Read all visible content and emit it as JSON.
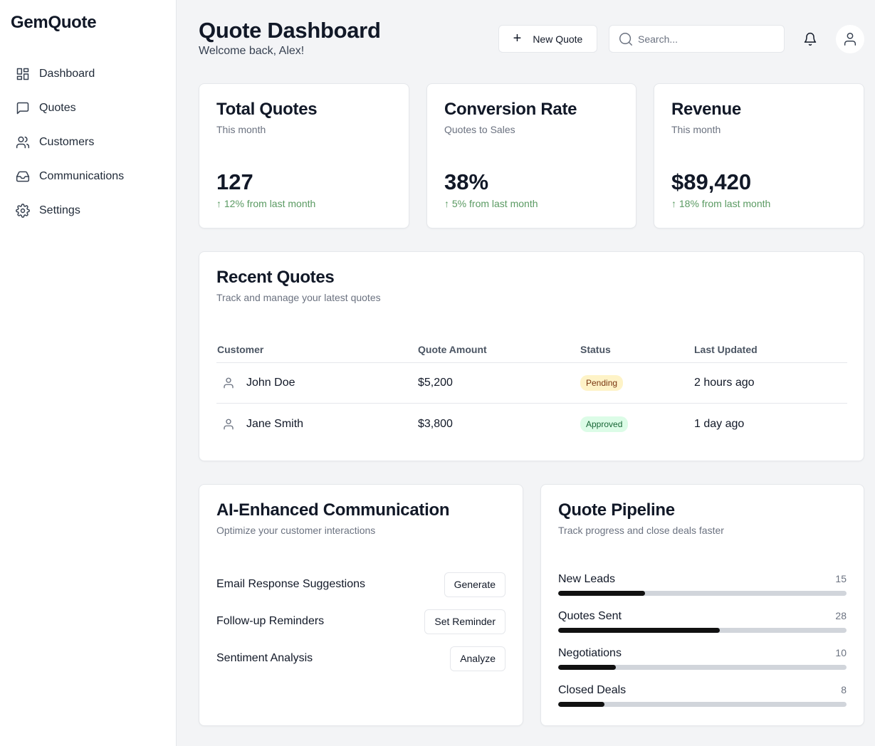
{
  "app": {
    "brand": "GemQuote"
  },
  "sidebar": {
    "items": [
      {
        "label": "Dashboard",
        "icon": "grid-icon"
      },
      {
        "label": "Quotes",
        "icon": "message-square-icon"
      },
      {
        "label": "Customers",
        "icon": "users-icon"
      },
      {
        "label": "Communications",
        "icon": "inbox-icon"
      },
      {
        "label": "Settings",
        "icon": "gear-icon"
      }
    ]
  },
  "header": {
    "title": "Quote Dashboard",
    "subtitle": "Welcome back, Alex!",
    "new_quote_label": "New Quote",
    "search_placeholder": "Search..."
  },
  "stats": [
    {
      "title": "Total Quotes",
      "subtitle": "This month",
      "value": "127",
      "change": "12% from last month"
    },
    {
      "title": "Conversion Rate",
      "subtitle": "Quotes to Sales",
      "value": "38%",
      "change": "5% from last month"
    },
    {
      "title": "Revenue",
      "subtitle": "This month",
      "value": "$89,420",
      "change": "18% from last month"
    }
  ],
  "recent": {
    "title": "Recent Quotes",
    "subtitle": "Track and manage your latest quotes",
    "columns": [
      "Customer",
      "Quote Amount",
      "Status",
      "Last Updated"
    ],
    "rows": [
      {
        "customer": "John Doe",
        "amount": "$5,200",
        "status": "Pending",
        "updated": "2 hours ago"
      },
      {
        "customer": "Jane Smith",
        "amount": "$3,800",
        "status": "Approved",
        "updated": "1 day ago"
      }
    ]
  },
  "ai": {
    "title": "AI-Enhanced Communication",
    "subtitle": "Optimize your customer interactions",
    "items": [
      {
        "label": "Email Response Suggestions",
        "action": "Generate"
      },
      {
        "label": "Follow-up Reminders",
        "action": "Set Reminder"
      },
      {
        "label": "Sentiment Analysis",
        "action": "Analyze"
      }
    ]
  },
  "pipeline": {
    "title": "Quote Pipeline",
    "subtitle": "Track progress and close deals faster",
    "stages": [
      {
        "label": "New Leads",
        "count": "15",
        "progress": 0.3
      },
      {
        "label": "Quotes Sent",
        "count": "28",
        "progress": 0.56
      },
      {
        "label": "Negotiations",
        "count": "10",
        "progress": 0.2
      },
      {
        "label": "Closed Deals",
        "count": "8",
        "progress": 0.16
      }
    ]
  },
  "colors": {
    "positive": "#5a9a62",
    "pending_bg": "#fef3c7",
    "approved_bg": "#dcfce7",
    "bar_fill": "#111111"
  }
}
